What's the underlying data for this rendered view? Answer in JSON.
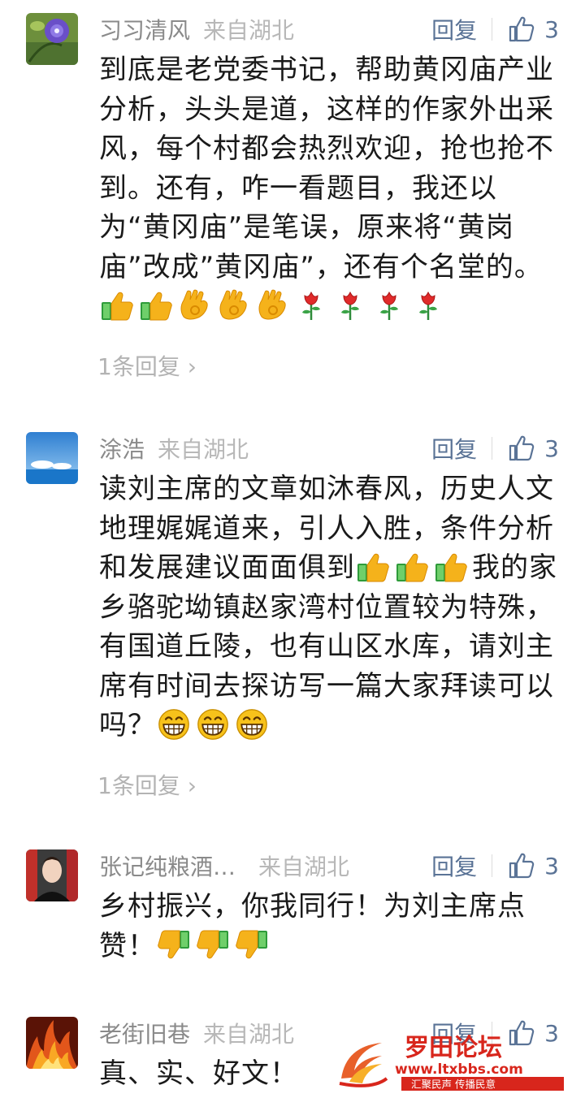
{
  "comments": [
    {
      "user": "习习清风",
      "origin": "来自湖北",
      "reply_label": "回复",
      "likes": "3",
      "text": "到底是老党委书记，帮助黄冈庙产业分析，头头是道，这样的作家外出采风，每个村都会热烈欢迎，抢也抢不到。还有，咋一看题目，我还以为“黄冈庙”是笔误，原来将“黄岗庙”改成”黄冈庙”，还有个名堂的。",
      "emojis": [
        "thumbs-up",
        "thumbs-up",
        "ok-hand",
        "ok-hand",
        "ok-hand",
        "rose",
        "rose",
        "rose",
        "rose"
      ],
      "more": "1条回复"
    },
    {
      "user": "涂浩",
      "origin": "来自湖北",
      "reply_label": "回复",
      "likes": "3",
      "text_a": "读刘主席的文章如沐春风，历史人文地理娓娓道来，引人入胜，条件分析和发展建议面面俱到",
      "emojis_a": [
        "thumbs-up",
        "thumbs-up",
        "thumbs-up"
      ],
      "text_b": "我的家乡骆驼坳镇赵家湾村位置较为特殊，有国道丘陵，也有山区水库，请刘主席有时间去探访写一篇大家拜读可以吗？",
      "emojis_b": [
        "grin",
        "grin",
        "grin"
      ],
      "more": "1条回复"
    },
    {
      "user": "张记纯粮酒…",
      "origin": "来自湖北",
      "reply_label": "回复",
      "likes": "3",
      "text": "乡村振兴，你我同行！为刘主席点赞！",
      "emojis": [
        "thumbs-down",
        "thumbs-down",
        "thumbs-down"
      ]
    },
    {
      "user": "老街旧巷",
      "origin": "来自湖北",
      "reply_label": "回复",
      "likes": "3",
      "text": "真、实、好文！"
    }
  ],
  "watermark": {
    "title": "罗田论坛",
    "url": "www.ltxbbs.com",
    "slogan": "汇聚民声 传播民意"
  },
  "colors": {
    "name": "#8a8a8a",
    "action": "#5a7396",
    "body": "#1a1a1a",
    "watermark_red": "#d8261c"
  }
}
